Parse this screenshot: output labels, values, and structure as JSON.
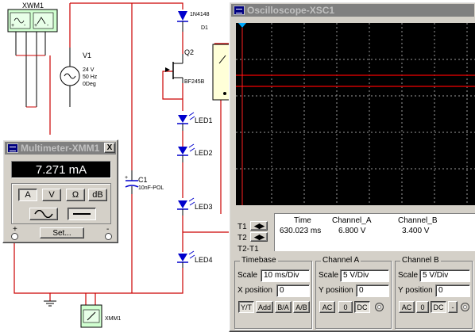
{
  "schematic": {
    "function_generator": {
      "label": "XWM1",
      "terminals": "+ ~ -"
    },
    "voltage_source": {
      "ref": "V1",
      "voltage": "24 V",
      "frequency": "50 Hz",
      "phase": "0Deg"
    },
    "diode": {
      "part": "1N4148",
      "ref": "D1"
    },
    "transistor": {
      "ref": "Q2",
      "part": "BF245B"
    },
    "leds": [
      "LED1",
      "LED2",
      "LED3",
      "LED4"
    ],
    "capacitor": {
      "ref": "C1",
      "value": "10nF-POL"
    },
    "meter_probe": {
      "label": "XMM1"
    },
    "colors": {
      "wire": "#cc0000",
      "instrument_wire": "#000000",
      "component": "#0000cc",
      "ground": "#000000"
    }
  },
  "multimeter": {
    "title": "Multimeter-XMM1",
    "reading": "7.271 mA",
    "mode_buttons": [
      "A",
      "V",
      "Ω",
      "dB"
    ],
    "active_mode": "A",
    "signal_buttons": [
      "AC",
      "DC"
    ],
    "active_signal": "DC",
    "set_button": "Set...",
    "terminals": {
      "plus": "+",
      "minus": "-"
    },
    "close_label": "X"
  },
  "oscilloscope": {
    "title": "Oscilloscope-XSC1",
    "readout": {
      "headers": {
        "time": "Time",
        "channel_a": "Channel_A",
        "channel_b": "Channel_B"
      },
      "rows": [
        {
          "label": "T1",
          "time": "630.023 ms",
          "channel_a": "6.800 V",
          "channel_b": "3.400 V"
        },
        {
          "label": "T2",
          "time": "",
          "channel_a": "",
          "channel_b": ""
        },
        {
          "label": "T2-T1",
          "time": "",
          "channel_a": "",
          "channel_b": ""
        }
      ]
    },
    "timebase": {
      "title": "Timebase",
      "scale_label": "Scale",
      "scale_value": "10 ms/Div",
      "xpos_label": "X position",
      "xpos_value": "0",
      "modes": [
        "Y/T",
        "Add",
        "B/A",
        "A/B"
      ],
      "active_mode": "Y/T"
    },
    "channel_a": {
      "title": "Channel A",
      "scale_label": "Scale",
      "scale_value": "5  V/Div",
      "ypos_label": "Y position",
      "ypos_value": "0",
      "coupling": [
        "AC",
        "0",
        "DC"
      ],
      "active_coupling": "DC"
    },
    "channel_b": {
      "title": "Channel B",
      "scale_label": "Scale",
      "scale_value": "5  V/Div",
      "ypos_label": "Y position",
      "ypos_value": "0",
      "coupling": [
        "AC",
        "0",
        "DC",
        "-"
      ],
      "active_coupling": "DC"
    },
    "trace_color": "#cc0000",
    "grid_color": "#b0b0b0"
  }
}
